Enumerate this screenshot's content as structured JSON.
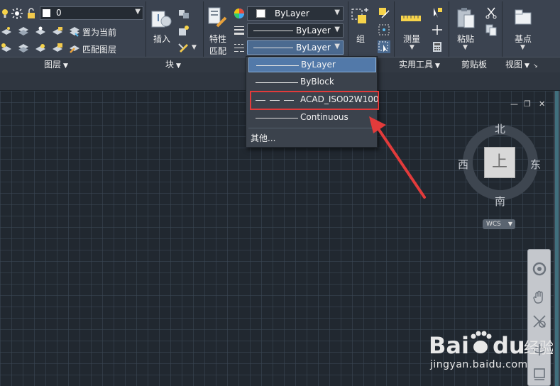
{
  "ribbon": {
    "layers_panel": {
      "title": "图层",
      "current_layer": "0",
      "set_current_label": "置为当前",
      "match_layer_label": "匹配图层"
    },
    "block_panel": {
      "title": "块",
      "insert_label": "插入"
    },
    "properties_panel": {
      "match_props_label_1": "特性",
      "match_props_label_2": "匹配",
      "color_value": "ByLayer",
      "lineweight_value": "ByLayer",
      "linetype_value": "ByLayer"
    },
    "groups_panel": {
      "group_label": "组"
    },
    "utilities_panel": {
      "title": "实用工具",
      "measure_label": "测量"
    },
    "clipboard_panel": {
      "title": "剪贴板",
      "paste_label": "粘贴"
    },
    "view_panel": {
      "title": "视图",
      "basepoint_label": "基点"
    }
  },
  "linetype_dropdown": {
    "items": [
      {
        "label": "ByLayer",
        "style": "solid",
        "selected": true
      },
      {
        "label": "ByBlock",
        "style": "solid",
        "selected": false
      },
      {
        "label": "ACAD_ISO02W100",
        "style": "dashed",
        "selected": false,
        "highlighted": true
      },
      {
        "label": "Continuous",
        "style": "solid",
        "selected": false
      }
    ],
    "other_label": "其他..."
  },
  "viewcube": {
    "top_face": "上",
    "north": "北",
    "south": "南",
    "east": "东",
    "west": "西",
    "ucs_label": "WCS"
  },
  "watermark": {
    "brand": "Bai du 经验",
    "url": "jingyan.baidu.com"
  },
  "colors": {
    "ribbon_bg": "#3b4350",
    "canvas_bg": "#212830",
    "highlight": "#e23b3b",
    "selection": "#5279a9"
  }
}
